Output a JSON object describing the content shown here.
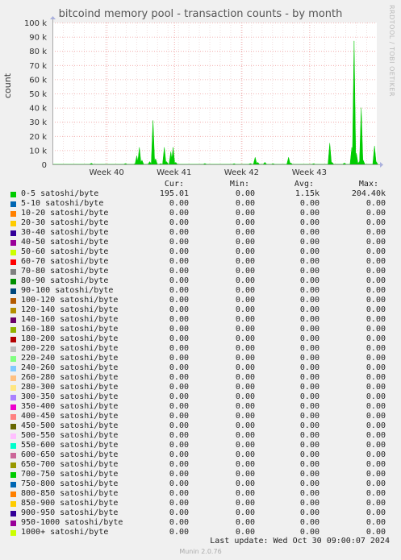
{
  "title": "bitcoind memory pool - transaction counts - by month",
  "watermark": "RRDTOOL / TOBI OETIKER",
  "footer": {
    "last_update": "Last update: Wed Oct 30 09:00:07 2024",
    "munin": "Munin 2.0.76"
  },
  "legend_headers": {
    "cur": "Cur:",
    "min": "Min:",
    "avg": "Avg:",
    "max": "Max:"
  },
  "chart_data": {
    "type": "area",
    "title": "bitcoind memory pool - transaction counts - by month",
    "ylabel": "count",
    "ylim": [
      0,
      100000
    ],
    "yticks": [
      "0",
      "10 k",
      "20 k",
      "30 k",
      "40 k",
      "50 k",
      "60 k",
      "70 k",
      "80 k",
      "90 k",
      "100 k"
    ],
    "xticks": [
      "Week 40",
      "Week 41",
      "Week 42",
      "Week 43"
    ],
    "grid": true,
    "series": [
      {
        "name": "0-5 satoshi/byte",
        "color": "#00cc00",
        "points": [
          [
            0.12,
            800
          ],
          [
            0.225,
            600
          ],
          [
            0.255,
            500
          ],
          [
            0.26,
            6000
          ],
          [
            0.268,
            12000
          ],
          [
            0.276,
            3000
          ],
          [
            0.3,
            2000
          ],
          [
            0.31,
            31000
          ],
          [
            0.318,
            4000
          ],
          [
            0.334,
            500
          ],
          [
            0.345,
            12000
          ],
          [
            0.352,
            2000
          ],
          [
            0.365,
            9000
          ],
          [
            0.372,
            12000
          ],
          [
            0.38,
            1500
          ],
          [
            0.47,
            600
          ],
          [
            0.56,
            500
          ],
          [
            0.61,
            600
          ],
          [
            0.625,
            5000
          ],
          [
            0.633,
            1500
          ],
          [
            0.655,
            1500
          ],
          [
            0.68,
            500
          ],
          [
            0.728,
            5000
          ],
          [
            0.735,
            1000
          ],
          [
            0.805,
            500
          ],
          [
            0.855,
            15000
          ],
          [
            0.862,
            1500
          ],
          [
            0.9,
            1000
          ],
          [
            0.923,
            12000
          ],
          [
            0.93,
            87000
          ],
          [
            0.937,
            8000
          ],
          [
            0.946,
            2000
          ],
          [
            0.952,
            40000
          ],
          [
            0.958,
            3000
          ],
          [
            0.993,
            13000
          ],
          [
            0.998,
            2000
          ]
        ]
      }
    ]
  },
  "legend": [
    {
      "label": "0-5 satoshi/byte",
      "color": "#00cc00",
      "cur": "195.01",
      "min": "0.00",
      "avg": "1.15k",
      "max": "204.40k"
    },
    {
      "label": "5-10 satoshi/byte",
      "color": "#0066b3",
      "cur": "0.00",
      "min": "0.00",
      "avg": "0.00",
      "max": "0.00"
    },
    {
      "label": "10-20 satoshi/byte",
      "color": "#ff8000",
      "cur": "0.00",
      "min": "0.00",
      "avg": "0.00",
      "max": "0.00"
    },
    {
      "label": "20-30 satoshi/byte",
      "color": "#ffcc00",
      "cur": "0.00",
      "min": "0.00",
      "avg": "0.00",
      "max": "0.00"
    },
    {
      "label": "30-40 satoshi/byte",
      "color": "#330099",
      "cur": "0.00",
      "min": "0.00",
      "avg": "0.00",
      "max": "0.00"
    },
    {
      "label": "40-50 satoshi/byte",
      "color": "#990099",
      "cur": "0.00",
      "min": "0.00",
      "avg": "0.00",
      "max": "0.00"
    },
    {
      "label": "50-60 satoshi/byte",
      "color": "#ccff00",
      "cur": "0.00",
      "min": "0.00",
      "avg": "0.00",
      "max": "0.00"
    },
    {
      "label": "60-70 satoshi/byte",
      "color": "#ff0000",
      "cur": "0.00",
      "min": "0.00",
      "avg": "0.00",
      "max": "0.00"
    },
    {
      "label": "70-80 satoshi/byte",
      "color": "#808080",
      "cur": "0.00",
      "min": "0.00",
      "avg": "0.00",
      "max": "0.00"
    },
    {
      "label": "80-90 satoshi/byte",
      "color": "#008f00",
      "cur": "0.00",
      "min": "0.00",
      "avg": "0.00",
      "max": "0.00"
    },
    {
      "label": "90-100 satoshi/byte",
      "color": "#00487d",
      "cur": "0.00",
      "min": "0.00",
      "avg": "0.00",
      "max": "0.00"
    },
    {
      "label": "100-120 satoshi/byte",
      "color": "#b35a00",
      "cur": "0.00",
      "min": "0.00",
      "avg": "0.00",
      "max": "0.00"
    },
    {
      "label": "120-140 satoshi/byte",
      "color": "#b38f00",
      "cur": "0.00",
      "min": "0.00",
      "avg": "0.00",
      "max": "0.00"
    },
    {
      "label": "140-160 satoshi/byte",
      "color": "#6b006b",
      "cur": "0.00",
      "min": "0.00",
      "avg": "0.00",
      "max": "0.00"
    },
    {
      "label": "160-180 satoshi/byte",
      "color": "#8fb300",
      "cur": "0.00",
      "min": "0.00",
      "avg": "0.00",
      "max": "0.00"
    },
    {
      "label": "180-200 satoshi/byte",
      "color": "#b30000",
      "cur": "0.00",
      "min": "0.00",
      "avg": "0.00",
      "max": "0.00"
    },
    {
      "label": "200-220 satoshi/byte",
      "color": "#bebebe",
      "cur": "0.00",
      "min": "0.00",
      "avg": "0.00",
      "max": "0.00"
    },
    {
      "label": "220-240 satoshi/byte",
      "color": "#80ff80",
      "cur": "0.00",
      "min": "0.00",
      "avg": "0.00",
      "max": "0.00"
    },
    {
      "label": "240-260 satoshi/byte",
      "color": "#80c9ff",
      "cur": "0.00",
      "min": "0.00",
      "avg": "0.00",
      "max": "0.00"
    },
    {
      "label": "260-280 satoshi/byte",
      "color": "#ffc080",
      "cur": "0.00",
      "min": "0.00",
      "avg": "0.00",
      "max": "0.00"
    },
    {
      "label": "280-300 satoshi/byte",
      "color": "#ffe680",
      "cur": "0.00",
      "min": "0.00",
      "avg": "0.00",
      "max": "0.00"
    },
    {
      "label": "300-350 satoshi/byte",
      "color": "#aa80ff",
      "cur": "0.00",
      "min": "0.00",
      "avg": "0.00",
      "max": "0.00"
    },
    {
      "label": "350-400 satoshi/byte",
      "color": "#ee00cc",
      "cur": "0.00",
      "min": "0.00",
      "avg": "0.00",
      "max": "0.00"
    },
    {
      "label": "400-450 satoshi/byte",
      "color": "#ff8080",
      "cur": "0.00",
      "min": "0.00",
      "avg": "0.00",
      "max": "0.00"
    },
    {
      "label": "450-500 satoshi/byte",
      "color": "#666600",
      "cur": "0.00",
      "min": "0.00",
      "avg": "0.00",
      "max": "0.00"
    },
    {
      "label": "500-550 satoshi/byte",
      "color": "#ffbfff",
      "cur": "0.00",
      "min": "0.00",
      "avg": "0.00",
      "max": "0.00"
    },
    {
      "label": "550-600 satoshi/byte",
      "color": "#00ffcc",
      "cur": "0.00",
      "min": "0.00",
      "avg": "0.00",
      "max": "0.00"
    },
    {
      "label": "600-650 satoshi/byte",
      "color": "#cc6699",
      "cur": "0.00",
      "min": "0.00",
      "avg": "0.00",
      "max": "0.00"
    },
    {
      "label": "650-700 satoshi/byte",
      "color": "#999900",
      "cur": "0.00",
      "min": "0.00",
      "avg": "0.00",
      "max": "0.00"
    },
    {
      "label": "700-750 satoshi/byte",
      "color": "#00cc00",
      "cur": "0.00",
      "min": "0.00",
      "avg": "0.00",
      "max": "0.00"
    },
    {
      "label": "750-800 satoshi/byte",
      "color": "#0066b3",
      "cur": "0.00",
      "min": "0.00",
      "avg": "0.00",
      "max": "0.00"
    },
    {
      "label": "800-850 satoshi/byte",
      "color": "#ff8000",
      "cur": "0.00",
      "min": "0.00",
      "avg": "0.00",
      "max": "0.00"
    },
    {
      "label": "850-900 satoshi/byte",
      "color": "#ffcc00",
      "cur": "0.00",
      "min": "0.00",
      "avg": "0.00",
      "max": "0.00"
    },
    {
      "label": "900-950 satoshi/byte",
      "color": "#330099",
      "cur": "0.00",
      "min": "0.00",
      "avg": "0.00",
      "max": "0.00"
    },
    {
      "label": "950-1000 satoshi/byte",
      "color": "#990099",
      "cur": "0.00",
      "min": "0.00",
      "avg": "0.00",
      "max": "0.00"
    },
    {
      "label": "1000+ satoshi/byte",
      "color": "#ccff00",
      "cur": "0.00",
      "min": "0.00",
      "avg": "0.00",
      "max": "0.00"
    }
  ]
}
